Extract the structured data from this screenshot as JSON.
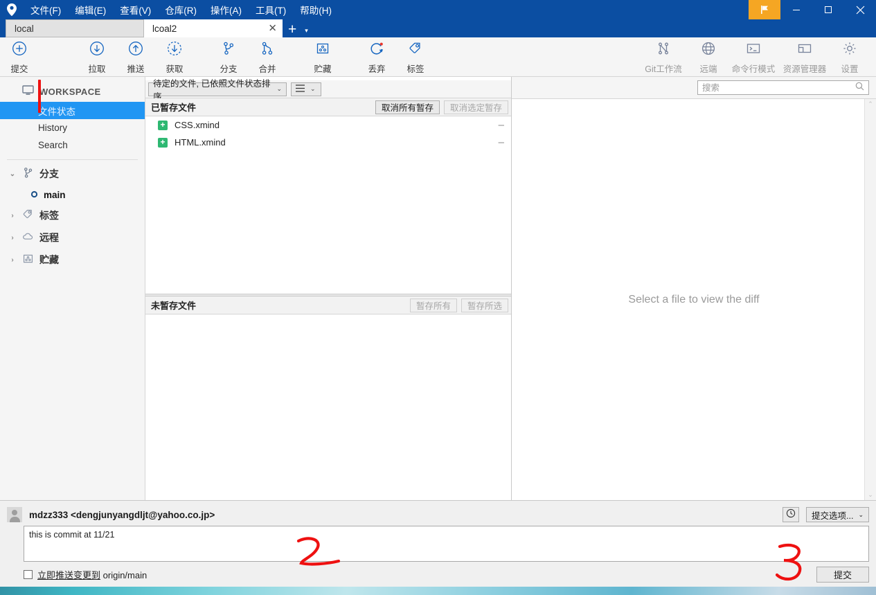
{
  "window": {
    "logo": "location-pin-icon",
    "flag_icon": "flag-icon",
    "minimize": "–",
    "maximize": "□",
    "close": "✕"
  },
  "menu": [
    {
      "label": "文件(F)",
      "name": "menu-file"
    },
    {
      "label": "编辑(E)",
      "name": "menu-edit"
    },
    {
      "label": "查看(V)",
      "name": "menu-view"
    },
    {
      "label": "仓库(R)",
      "name": "menu-repository"
    },
    {
      "label": "操作(A)",
      "name": "menu-actions"
    },
    {
      "label": "工具(T)",
      "name": "menu-tools"
    },
    {
      "label": "帮助(H)",
      "name": "menu-help"
    }
  ],
  "tabs": {
    "inactive": "local",
    "active": "lcoal2",
    "close_glyph": "✕",
    "add_glyph": "+",
    "caret_glyph": "▾"
  },
  "toolbar": {
    "left": [
      {
        "label": "提交",
        "icon": "commit-plus-icon"
      },
      {
        "label": "拉取",
        "icon": "pull-down-arrow-icon"
      },
      {
        "label": "推送",
        "icon": "push-up-arrow-icon"
      },
      {
        "label": "获取",
        "icon": "fetch-dashed-arrow-icon"
      },
      {
        "label": "分支",
        "icon": "branch-icon"
      },
      {
        "label": "合并",
        "icon": "merge-icon"
      },
      {
        "label": "贮藏",
        "icon": "stash-box-icon"
      },
      {
        "label": "丢弃",
        "icon": "discard-refresh-icon"
      },
      {
        "label": "标签",
        "icon": "tag-icon"
      }
    ],
    "right": [
      {
        "label": "Git工作流",
        "icon": "gitflow-icon"
      },
      {
        "label": "远端",
        "icon": "globe-icon"
      },
      {
        "label": "命令行模式",
        "icon": "terminal-icon"
      },
      {
        "label": "资源管理器",
        "icon": "folder-explorer-icon"
      },
      {
        "label": "设置",
        "icon": "gear-icon"
      }
    ]
  },
  "sidebar": {
    "workspace_label": "WORKSPACE",
    "workspace_icon": "monitor-icon",
    "items": [
      {
        "label": "文件状态",
        "selected": true
      },
      {
        "label": "History",
        "selected": false
      },
      {
        "label": "Search",
        "selected": false
      }
    ],
    "groups": [
      {
        "label": "分支",
        "icon": "branch-icon",
        "expanded": true,
        "chevron": "⌄"
      },
      {
        "label": "标签",
        "icon": "tag-icon",
        "expanded": false,
        "chevron": "›"
      },
      {
        "label": "远程",
        "icon": "cloud-icon",
        "expanded": false,
        "chevron": "›"
      },
      {
        "label": "贮藏",
        "icon": "stash-box-icon",
        "expanded": false,
        "chevron": "›"
      }
    ],
    "branch": {
      "label": "main",
      "icon": "branch-dot-icon"
    }
  },
  "filepanel": {
    "sort_label": "待定的文件, 已依照文件状态排序",
    "sort_caret": "⌄",
    "view_icon": "list-view-icon",
    "view_caret": "⌄",
    "staged": {
      "title": "已暂存文件",
      "unstage_all": "取消所有暂存",
      "unstage_selected": "取消选定暂存",
      "files": [
        {
          "name": "CSS.xmind",
          "status": "+",
          "remove": "–"
        },
        {
          "name": "HTML.xmind",
          "status": "+",
          "remove": "–"
        }
      ]
    },
    "unstaged": {
      "title": "未暂存文件",
      "stage_all": "暂存所有",
      "stage_selected": "暂存所选",
      "files": []
    }
  },
  "diff": {
    "search_placeholder": "搜索",
    "search_value": "",
    "search_icon": "search-icon",
    "empty_text": "Select a file to view the diff",
    "scroll_up": "⌃",
    "scroll_down": "⌄"
  },
  "commit": {
    "author": "mdzz333 <dengjunyangdljt@yahoo.co.jp>",
    "avatar_icon": "user-avatar-icon",
    "history_icon": "clock-icon",
    "options_label": "提交选项...",
    "options_caret": "⌄",
    "message": "this is commit at 11/21",
    "push_checkbox_label_1": "立即推送变更到",
    "push_checkbox_label_2": "origin/main",
    "commit_button": "提交"
  },
  "annotations": {
    "mark1": "red-vertical-stroke",
    "mark2": "2",
    "mark3": "3",
    "color": "#ee1111"
  }
}
